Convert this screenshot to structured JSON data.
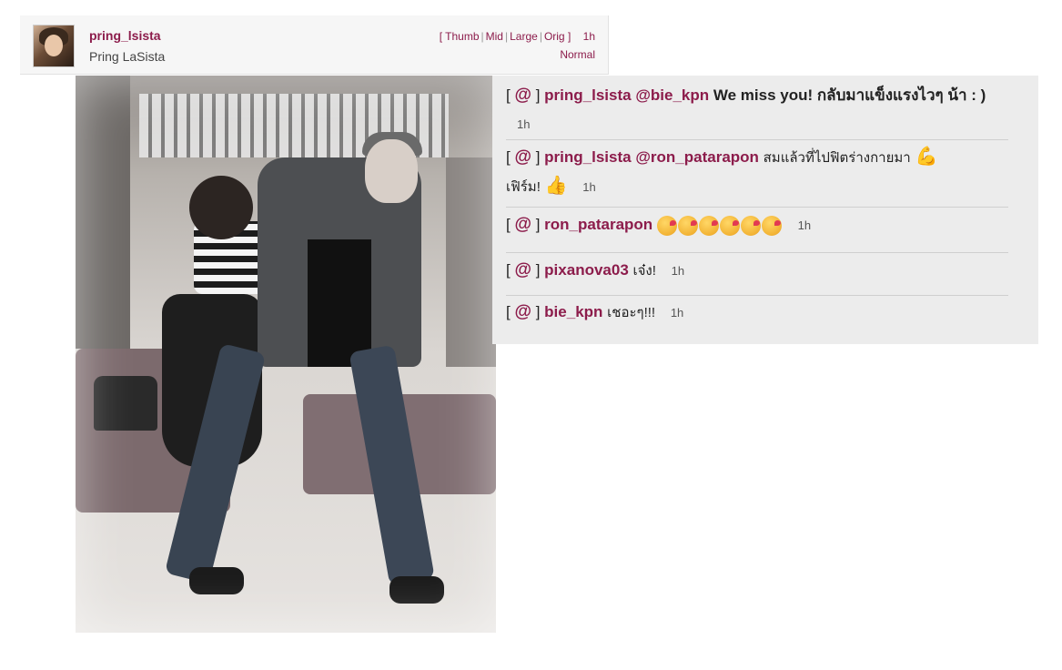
{
  "header": {
    "username": "pring_lsista",
    "fullname": "Pring LaSista",
    "sizes": [
      "Thumb",
      "Mid",
      "Large",
      "Orig"
    ],
    "bracket_open": "[",
    "bracket_close": "]",
    "time": "1h",
    "filter": "Normal"
  },
  "comments": [
    {
      "user": "pring_lsista",
      "mention": "@bie_kpn",
      "text": "We miss you! กลับมาแข็งแรงไวๆ น้า : )",
      "time": "1h"
    },
    {
      "user": "pring_lsista",
      "mention": "@ron_patarapon",
      "text_a": "สมแล้วที่ไปฟิตร่างกายมา",
      "text_b": "เฟิร์ม!",
      "time": "1h"
    },
    {
      "user": "ron_patarapon",
      "time": "1h"
    },
    {
      "user": "pixanova03",
      "text": "เจ๋ง!",
      "time": "1h"
    },
    {
      "user": "bie_kpn",
      "text": "เชอะๆ!!!",
      "time": "1h"
    }
  ],
  "reply_label": "@",
  "icons": {
    "muscle": "flexed-biceps-icon",
    "thumb": "thumbs-up-icon",
    "kiss": "face-blowing-kiss-icon"
  },
  "colors": {
    "accent": "#8c1c4b",
    "panel": "#ececec"
  }
}
